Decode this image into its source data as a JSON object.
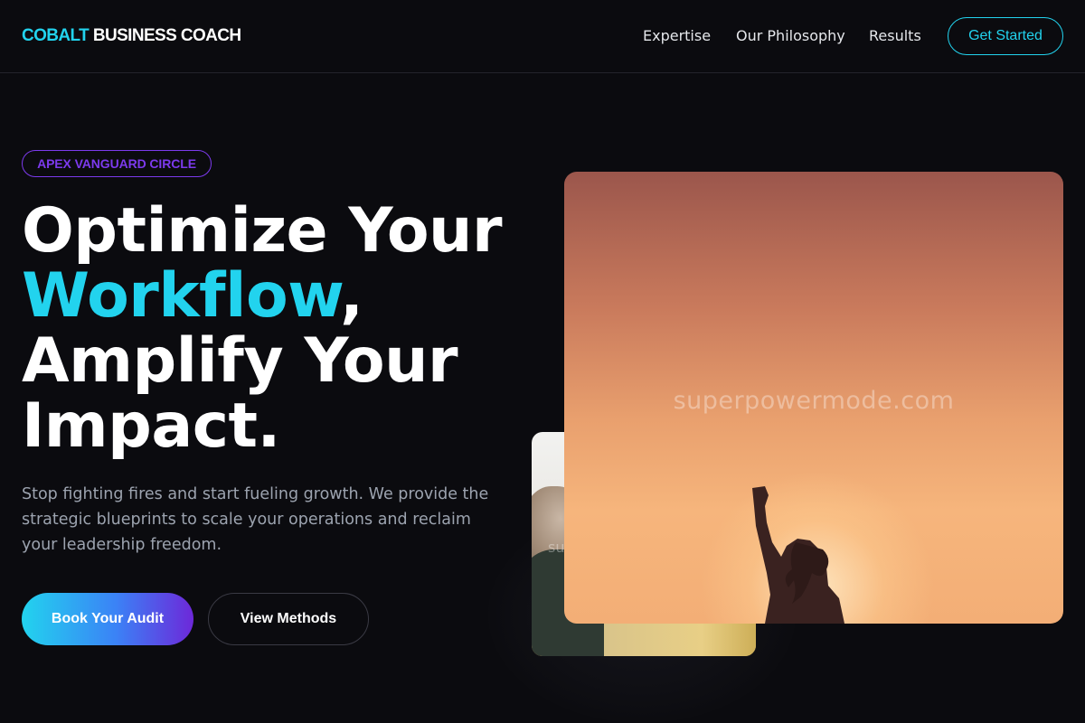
{
  "header": {
    "logo_accent": "COBALT",
    "logo_rest": "BUSINESS COACH",
    "nav": [
      "Expertise",
      "Our Philosophy",
      "Results"
    ],
    "cta": "Get Started"
  },
  "hero": {
    "badge": "APEX VANGUARD CIRCLE",
    "headline": {
      "line1": "Optimize Your",
      "highlight": "Workflow",
      "comma": ",",
      "line3": "Amplify Your",
      "line4": "Impact."
    },
    "subtext": "Stop fighting fires and start fueling growth. We provide the strategic blueprints to scale your operations and reclaim your leadership freedom.",
    "primary_button": "Book Your Audit",
    "secondary_button": "View Methods"
  },
  "images": {
    "large_watermark": "superpowermode.com",
    "small_watermark": "su"
  },
  "colors": {
    "accent_cyan": "#22d3ee",
    "accent_violet": "#7c3aed",
    "background": "#0b0b0f"
  }
}
